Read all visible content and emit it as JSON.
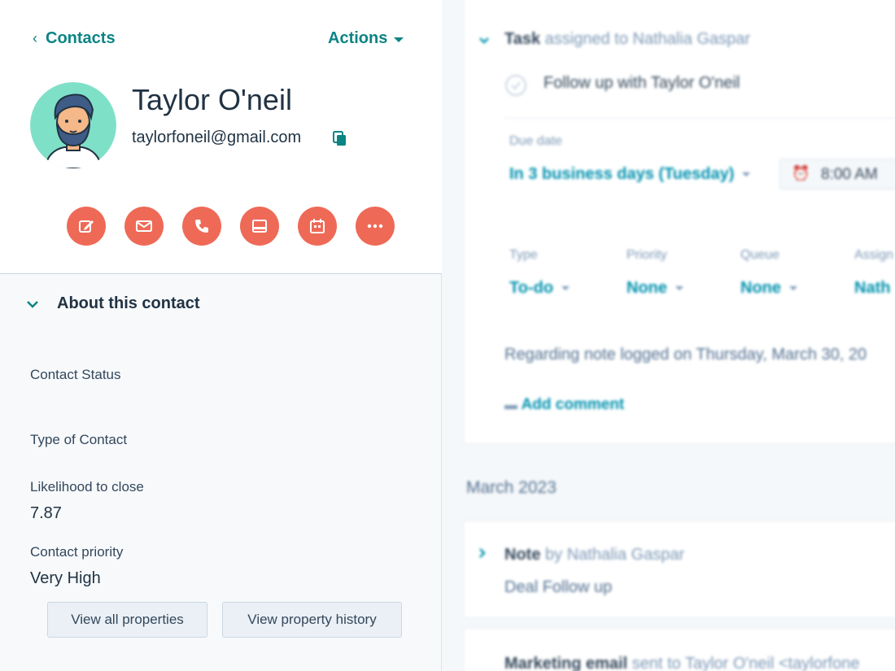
{
  "header": {
    "back_label": "Contacts",
    "actions_label": "Actions"
  },
  "contact": {
    "name": "Taylor O'neil",
    "email": "taylorfoneil@gmail.com"
  },
  "action_buttons": [
    {
      "name": "note",
      "icon": "edit-note-icon"
    },
    {
      "name": "email",
      "icon": "email-icon"
    },
    {
      "name": "call",
      "icon": "phone-icon"
    },
    {
      "name": "task",
      "icon": "task-icon"
    },
    {
      "name": "meeting",
      "icon": "calendar-icon"
    },
    {
      "name": "more",
      "icon": "more-icon"
    }
  ],
  "about": {
    "title": "About this contact",
    "properties": [
      {
        "label": "Contact Status",
        "value": ""
      },
      {
        "label": "Type of Contact",
        "value": ""
      },
      {
        "label": "Likelihood to close",
        "value": "7.87"
      },
      {
        "label": "Contact priority",
        "value": "Very High"
      }
    ],
    "view_all_label": "View all properties",
    "view_history_label": "View property history"
  },
  "timeline": {
    "task": {
      "type_label": "Task",
      "assigned_text": "assigned to Nathalia Gaspar",
      "title": "Follow up with Taylor O'neil",
      "due_date_label": "Due date",
      "due_date_value": "In 3 business days (Tuesday)",
      "time_value": "8:00 AM",
      "type_field_label": "Type",
      "type_field_value": "To-do",
      "priority_label": "Priority",
      "priority_value": "None",
      "queue_label": "Queue",
      "queue_value": "None",
      "assigned_label": "Assign",
      "assigned_value": "Nath",
      "regarding_text": "Regarding note logged on Thursday, March 30, 20",
      "add_comment_label": "Add comment"
    },
    "month_header": "March 2023",
    "note": {
      "type_label": "Note",
      "by_text": "by Nathalia Gaspar",
      "body": "Deal Follow up"
    },
    "marketing_email": {
      "type_label": "Marketing email",
      "sent_text": "sent to Taylor O'neil <taylorfone"
    }
  },
  "colors": {
    "accent": "#0b8484",
    "action_button": "#ee6a57",
    "link": "#0091ae",
    "avatar_bg": "#7fe0c8"
  }
}
